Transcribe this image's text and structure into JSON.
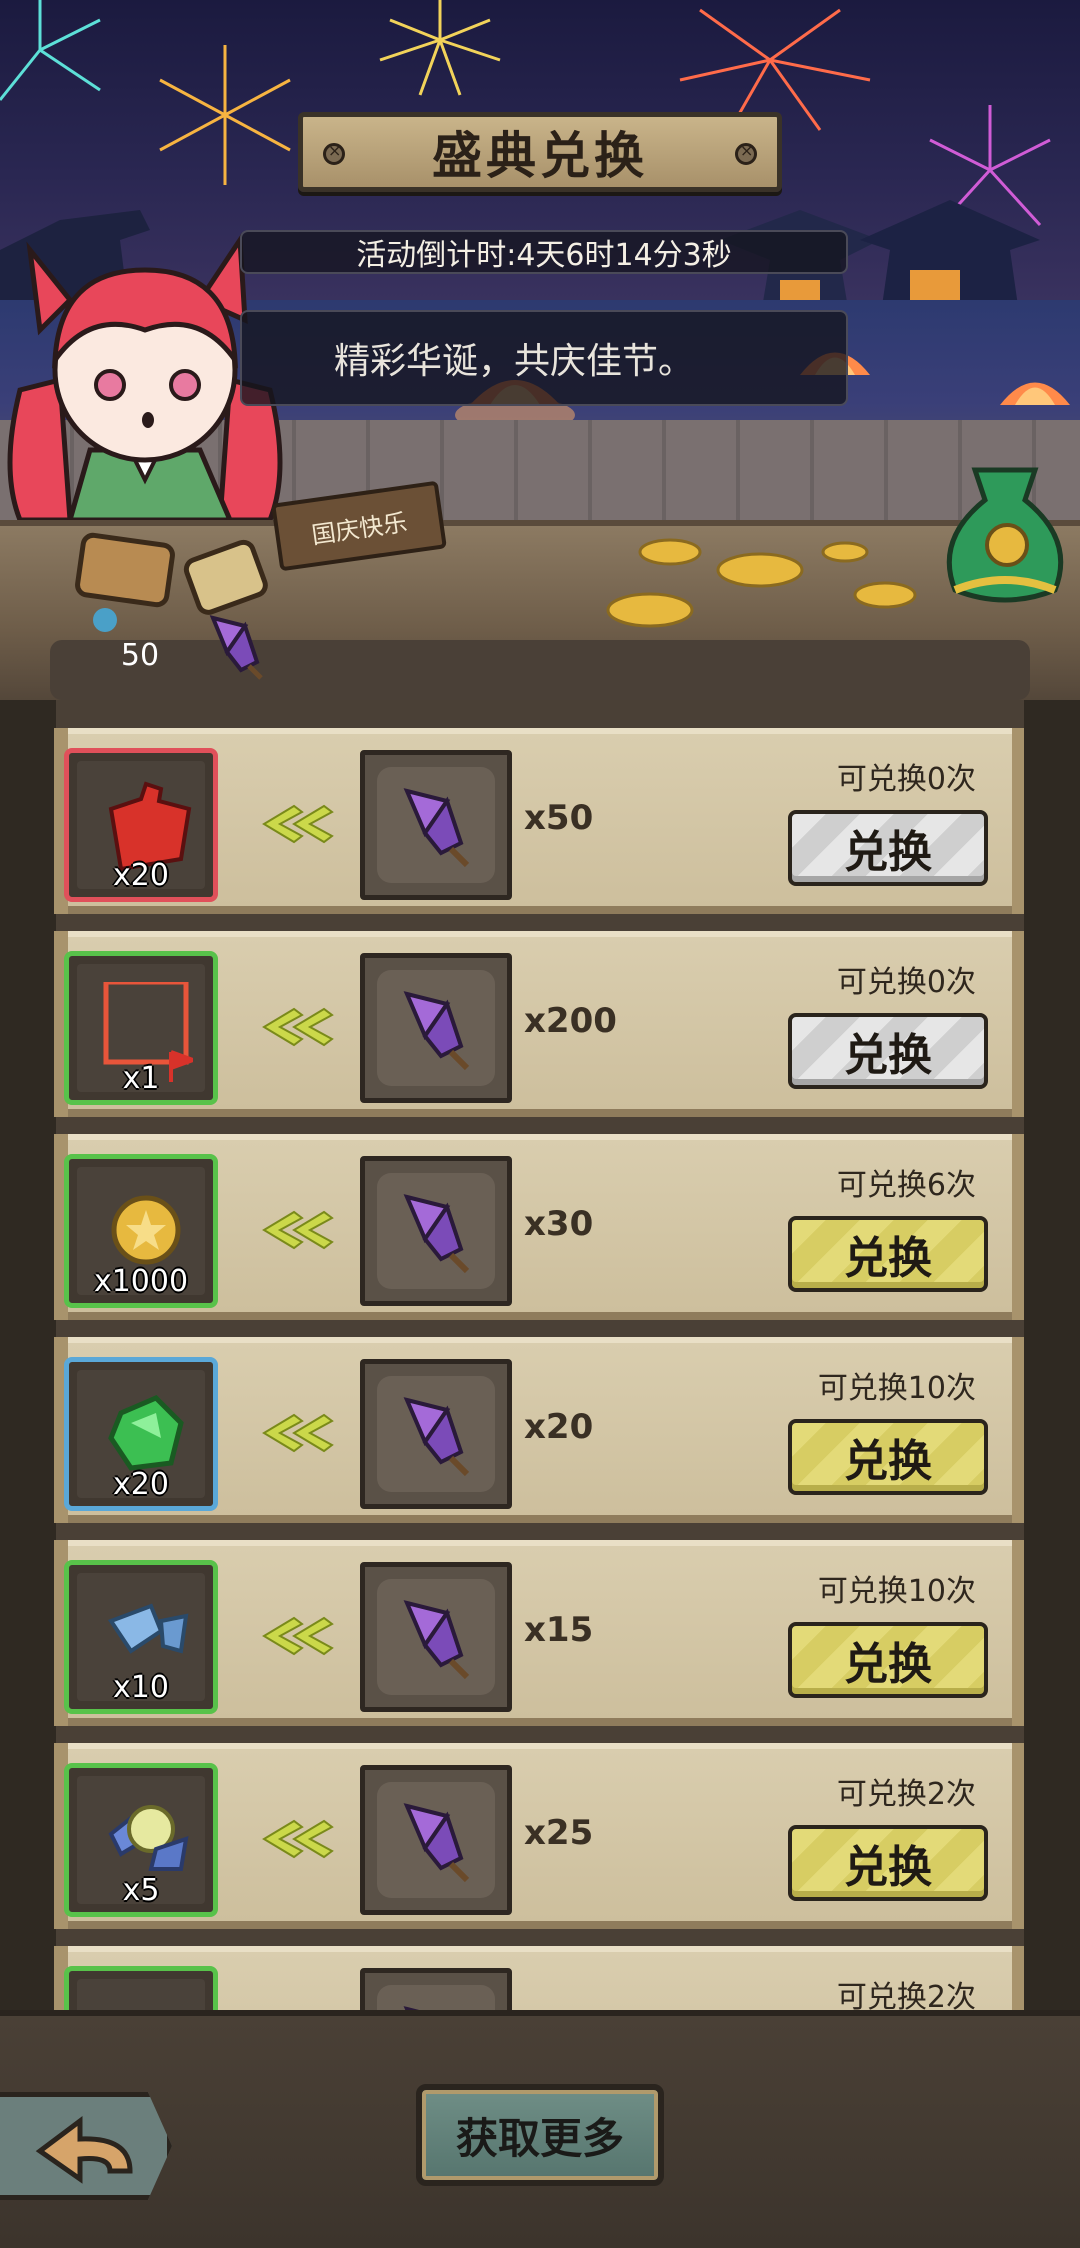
{
  "header": {
    "title": "盛典兑换",
    "countdown": "活动倒计时:4天6时14分3秒",
    "slogan": "精彩华诞，共庆佳节。",
    "sign": "国庆快乐",
    "currency_amount": "50"
  },
  "items": [
    {
      "reward": "red-puzzle-piece",
      "reward_qty": "x20",
      "border": "#e0505a",
      "cost_qty": "x50",
      "limit": "可兑换0次",
      "button": "兑换",
      "enabled": false
    },
    {
      "reward": "frame-with-flag",
      "reward_qty": "x1",
      "border": "#58c24a",
      "cost_qty": "x200",
      "limit": "可兑换0次",
      "button": "兑换",
      "enabled": false
    },
    {
      "reward": "gold-coin",
      "reward_qty": "x1000",
      "border": "#58c24a",
      "cost_qty": "x30",
      "limit": "可兑换6次",
      "button": "兑换",
      "enabled": true
    },
    {
      "reward": "green-gem",
      "reward_qty": "x20",
      "border": "#5aa8d8",
      "cost_qty": "x20",
      "limit": "可兑换10次",
      "button": "兑换",
      "enabled": true
    },
    {
      "reward": "blue-stone-fragment",
      "reward_qty": "x10",
      "border": "#58c24a",
      "cost_qty": "x15",
      "limit": "可兑换10次",
      "button": "兑换",
      "enabled": true
    },
    {
      "reward": "ore-cluster",
      "reward_qty": "x5",
      "border": "#58c24a",
      "cost_qty": "x25",
      "limit": "可兑换2次",
      "button": "兑换",
      "enabled": true
    },
    {
      "reward": "partial-item",
      "reward_qty": "",
      "border": "#58c24a",
      "cost_qty": "",
      "limit": "可兑换2次",
      "button": "",
      "enabled": true
    }
  ],
  "footer": {
    "more_label": "获取更多"
  }
}
